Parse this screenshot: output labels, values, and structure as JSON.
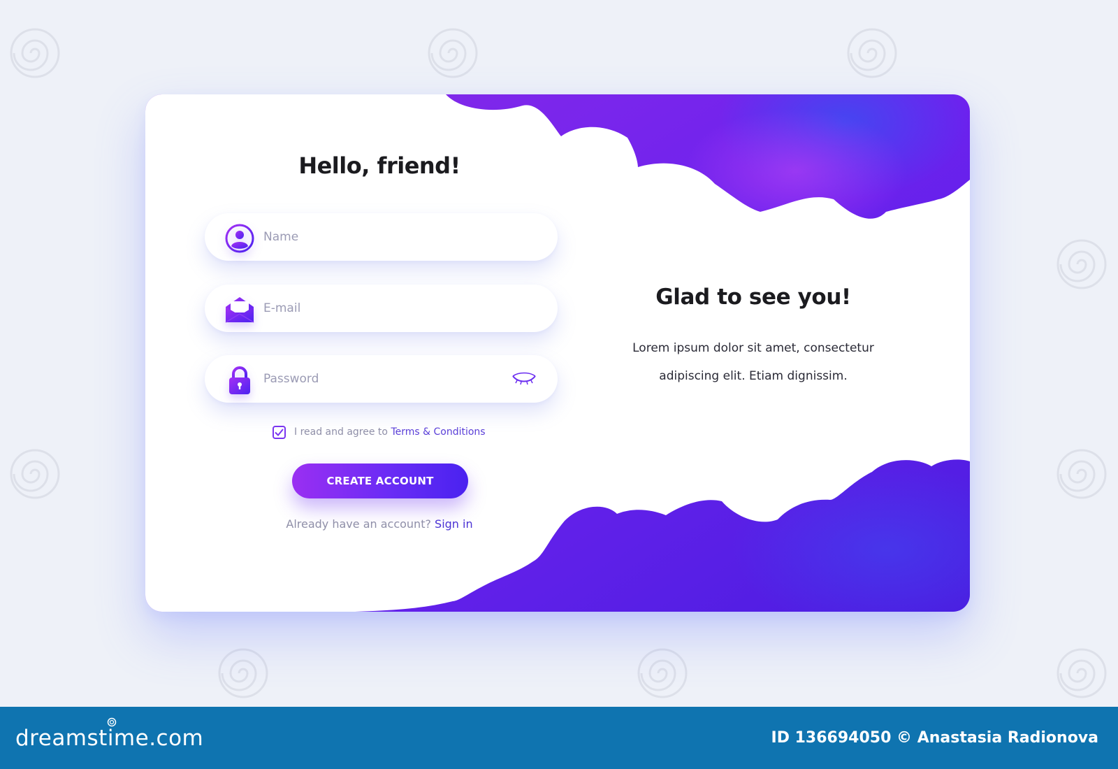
{
  "form": {
    "title": "Hello, friend!",
    "fields": [
      {
        "placeholder": "Name",
        "value": "",
        "icon": "user-icon"
      },
      {
        "placeholder": "E-mail",
        "value": "",
        "icon": "envelope-icon"
      },
      {
        "placeholder": "Password",
        "value": "",
        "icon": "lock-icon",
        "toggle_icon": "eye-closed-icon"
      }
    ],
    "terms_prefix": "I read and agree to ",
    "terms_link": "Terms & Conditions",
    "terms_checked": true,
    "submit_label": "CREATE ACCOUNT",
    "signin_prefix": "Already have an account? ",
    "signin_link": "Sign in"
  },
  "welcome": {
    "title": "Glad to see you!",
    "body": "Lorem ipsum dolor sit amet, consectetur adipiscing elit. Etiam dignissim."
  },
  "footer": {
    "logo": "dreamstime.com",
    "credit": "ID 136694050 © Anastasia Radionova"
  },
  "colors": {
    "accent_start": "#9a2ff2",
    "accent_end": "#4a22f0",
    "page_bg": "#eef1f8",
    "footer_bg": "#0f74b0",
    "link": "#4a32d4"
  }
}
